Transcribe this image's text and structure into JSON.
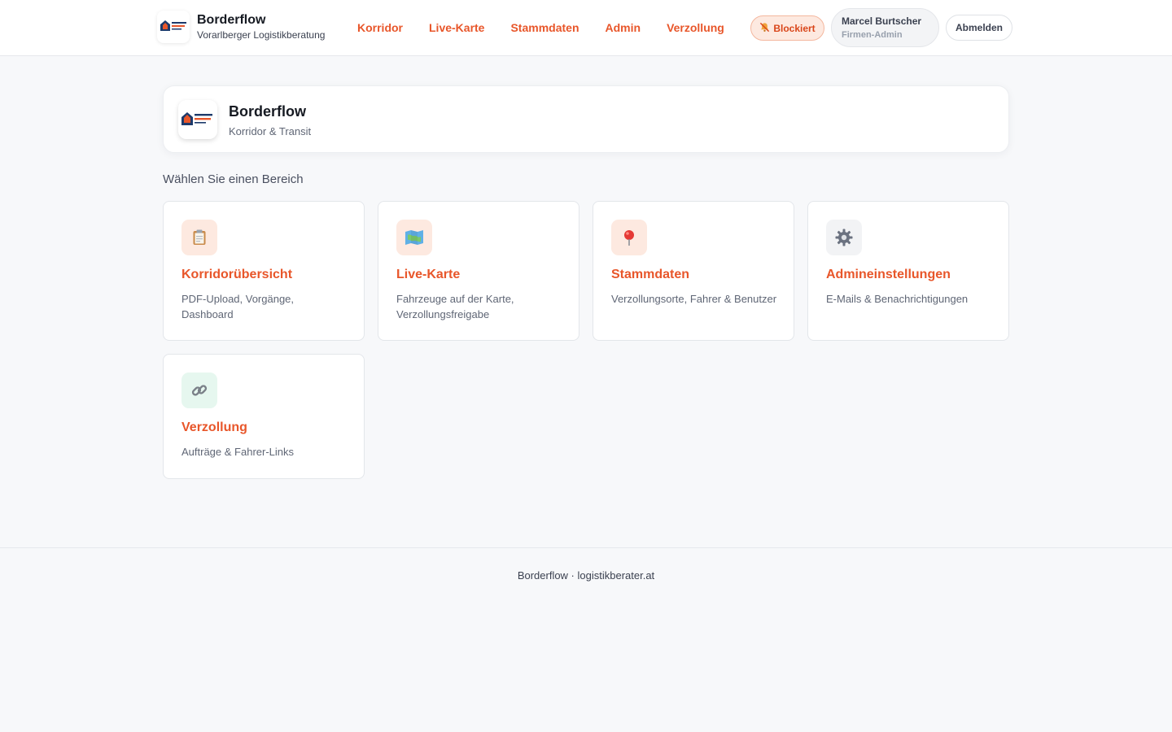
{
  "header": {
    "logo_icon": "company-logo",
    "brand_title": "Borderflow",
    "brand_subtitle": "Vorarlberger Logistikberatung",
    "nav": [
      {
        "label": "Korridor"
      },
      {
        "label": "Live-Karte"
      },
      {
        "label": "Stammdaten"
      },
      {
        "label": "Admin"
      },
      {
        "label": "Verzollung"
      }
    ],
    "status_badge": {
      "label": "Blockiert",
      "icon": "bell-muted-icon"
    },
    "user": {
      "name": "Marcel Burtscher",
      "role": "Firmen-Admin"
    },
    "logout_label": "Abmelden"
  },
  "hero": {
    "logo_icon": "company-logo",
    "title": "Borderflow",
    "subtitle": "Korridor & Transit"
  },
  "section_label": "Wählen Sie einen Bereich",
  "tiles": [
    {
      "icon": "clipboard-icon",
      "title": "Korridorübersicht",
      "description": "PDF-Upload, Vorgänge, Dashboard",
      "icon_bg": "#fde9e0"
    },
    {
      "icon": "map-icon",
      "title": "Live-Karte",
      "description": "Fahrzeuge auf der Karte, Verzollungsfreigabe",
      "icon_bg": "#fde9e0"
    },
    {
      "icon": "pin-icon",
      "title": "Stammdaten",
      "description": "Verzollungsorte, Fahrer & Benutzer",
      "icon_bg": "#fde9e0"
    },
    {
      "icon": "gear-icon",
      "title": "Admineinstellungen",
      "description": "E-Mails & Benachrichtigungen",
      "icon_bg": "#f2f3f5"
    },
    {
      "icon": "link-icon",
      "title": "Verzollung",
      "description": "Aufträge & Fahrer-Links",
      "icon_bg": "#e6f7ef"
    }
  ],
  "footer": {
    "text": "Borderflow · logistikberater.at"
  },
  "colors": {
    "accent": "#e8562a",
    "background": "#f7f8fa"
  }
}
